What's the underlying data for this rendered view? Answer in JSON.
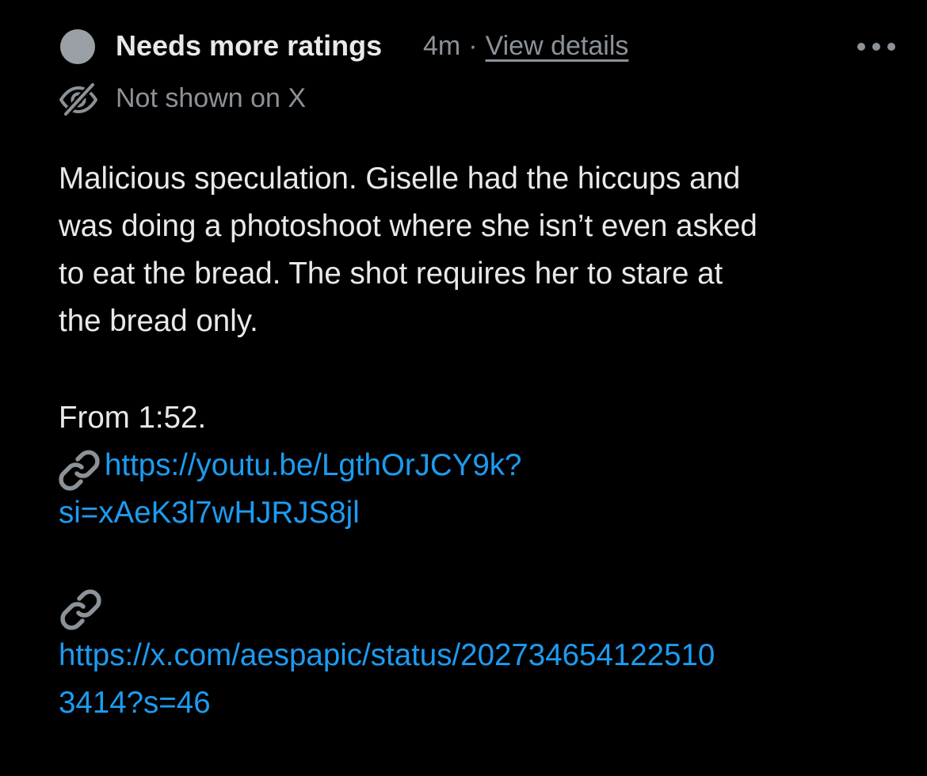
{
  "note": {
    "status_title": "Needs more ratings",
    "time": "4m",
    "separator": "·",
    "view_details": "View details",
    "visibility": "Not shown on X",
    "body": "Malicious speculation. Giselle had the hiccups and\nwas doing a photoshoot where she isn’t even asked\nto eat the bread. The shot requires her to stare at\nthe bread only.",
    "from": "From 1:52.",
    "links": [
      {
        "line1": "https://youtu.be/LgthOrJCY9k?",
        "line2": "si=xAeK3l7wHJRJS8jl"
      },
      {
        "line1": "https://x.com/aespapic/status/202734654122510",
        "line2": "3414?s=46"
      }
    ]
  },
  "icons": {
    "status": "gray-circle-icon",
    "more": "more-options-icon",
    "visibility": "eye-slash-icon",
    "link": "link-icon"
  },
  "colors": {
    "background": "#000000",
    "text": "#e7e9ea",
    "muted": "#8b9298",
    "link": "#1d9bf0",
    "status_dot": "#9aa0a6"
  }
}
